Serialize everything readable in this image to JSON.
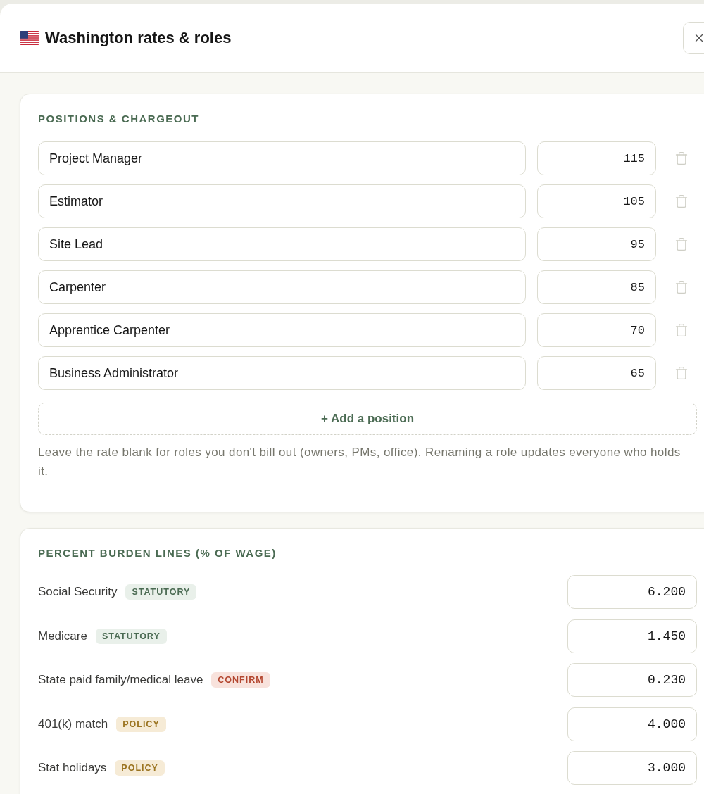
{
  "header": {
    "title": "Washington rates & roles"
  },
  "positions": {
    "heading": "POSITIONS & CHARGEOUT",
    "rows": [
      {
        "name": "Project Manager",
        "rate": "115"
      },
      {
        "name": "Estimator",
        "rate": "105"
      },
      {
        "name": "Site Lead",
        "rate": "95"
      },
      {
        "name": "Carpenter",
        "rate": "85"
      },
      {
        "name": "Apprentice Carpenter",
        "rate": "70"
      },
      {
        "name": "Business Administrator",
        "rate": "65"
      }
    ],
    "add_button": "+ Add a position",
    "note": "Leave the rate blank for roles you don't bill out (owners, PMs, office). Renaming a role updates everyone who holds it."
  },
  "burden": {
    "heading": "PERCENT BURDEN LINES (% OF WAGE)",
    "rows": [
      {
        "label": "Social Security",
        "tag": {
          "text": "STATUTORY",
          "kind": "statutory"
        },
        "value": "6.200"
      },
      {
        "label": "Medicare",
        "tag": {
          "text": "STATUTORY",
          "kind": "statutory"
        },
        "value": "1.450"
      },
      {
        "label": "State paid family/medical leave",
        "tag": {
          "text": "CONFIRM",
          "kind": "confirm"
        },
        "value": "0.230"
      },
      {
        "label": "401(k) match",
        "tag": {
          "text": "POLICY",
          "kind": "policy"
        },
        "value": "4.000"
      },
      {
        "label": "Stat holidays",
        "tag": {
          "text": "POLICY",
          "kind": "policy"
        },
        "value": "3.000"
      }
    ]
  }
}
